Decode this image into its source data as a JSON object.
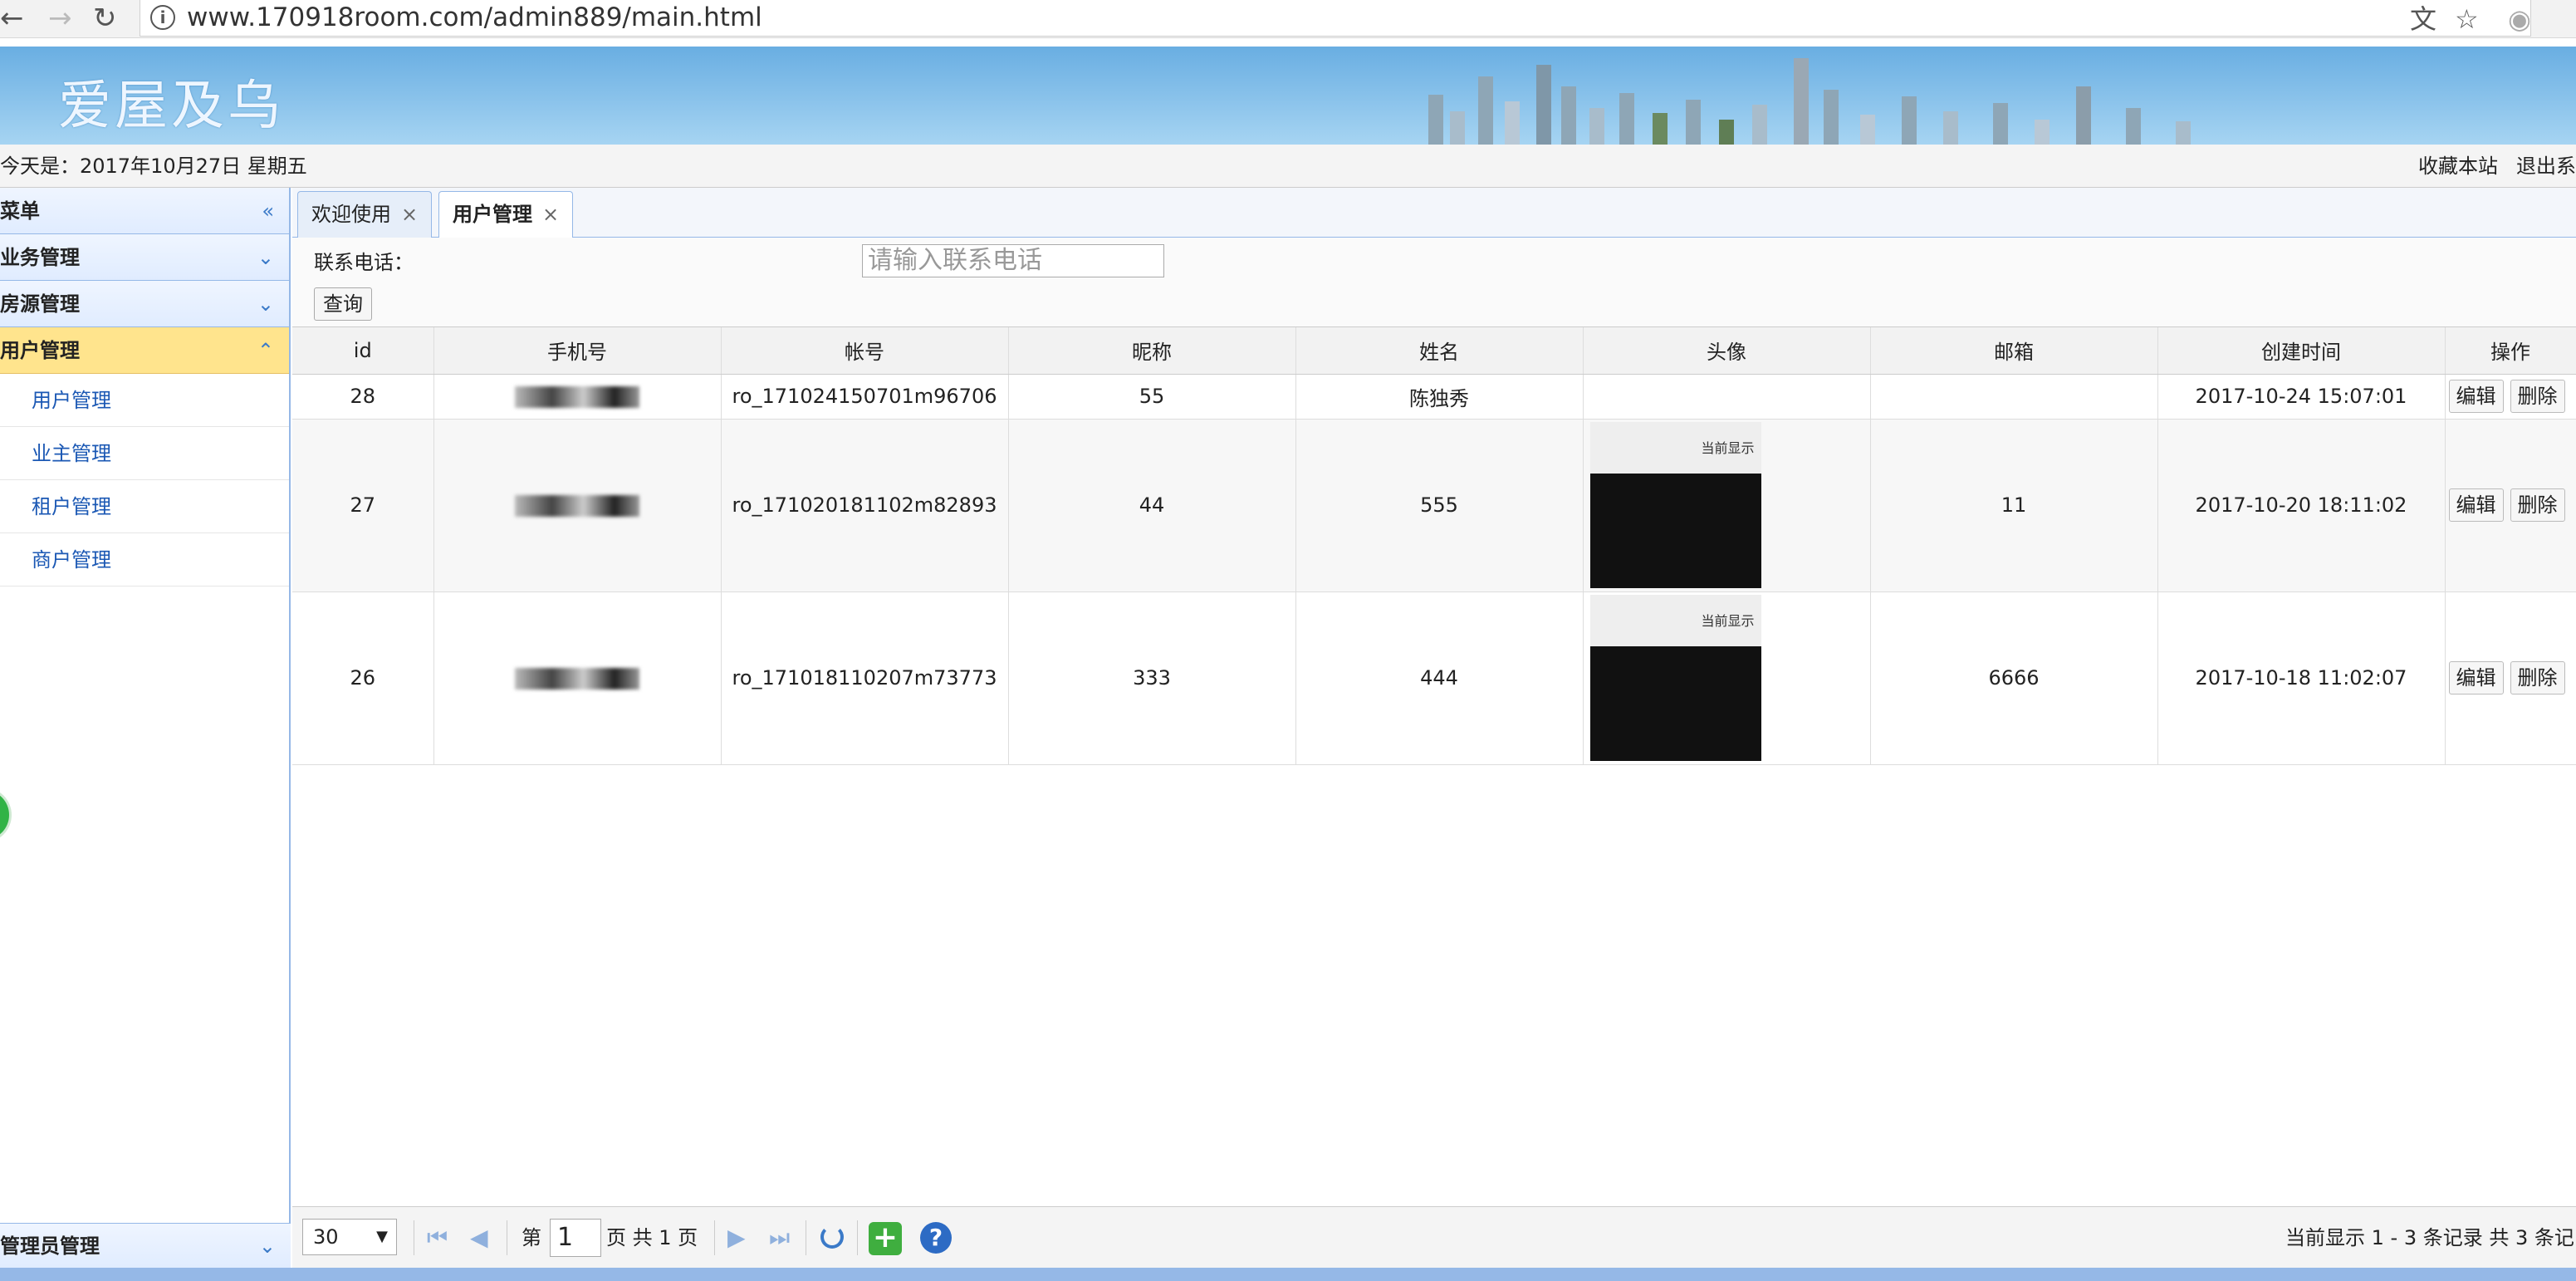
{
  "browser": {
    "url": "www.170918room.com/admin889/main.html",
    "back_icon": "arrow-left-icon",
    "forward_icon": "arrow-right-icon",
    "reload_icon": "reload-icon"
  },
  "banner": {
    "title": "爱屋及乌"
  },
  "datebar": {
    "date": "今天是：2017年10月27日 星期五",
    "favorite": "收藏本站",
    "logout": "退出系"
  },
  "sidebar": {
    "header": "菜单",
    "groups": [
      {
        "label": "业务管理"
      },
      {
        "label": "房源管理"
      },
      {
        "label": "用户管理"
      }
    ],
    "items": [
      {
        "label": "用户管理"
      },
      {
        "label": "业主管理"
      },
      {
        "label": "租户管理"
      },
      {
        "label": "商户管理"
      }
    ],
    "bottom": "管理员管理"
  },
  "tabs": [
    {
      "label": "欢迎使用"
    },
    {
      "label": "用户管理"
    }
  ],
  "search": {
    "phone_label": "联系电话：",
    "phone_placeholder": "请输入联系电话",
    "query_button": "查询"
  },
  "table": {
    "headers": [
      "id",
      "手机号",
      "帐号",
      "昵称",
      "姓名",
      "头像",
      "邮箱",
      "创建时间",
      "操作"
    ],
    "rows": [
      {
        "id": "28",
        "phone": "13077062803",
        "account": "ro_171024150701m96706",
        "nickname": "55",
        "name": "陈独秀",
        "email": "",
        "created": "2017-10-24 15:07:01"
      },
      {
        "id": "27",
        "phone": "13077062805",
        "account": "ro_171020181102m82893",
        "nickname": "44",
        "name": "555",
        "email": "11",
        "created": "2017-10-20 18:11:02"
      },
      {
        "id": "26",
        "phone": "",
        "account": "ro_171018110207m73773",
        "nickname": "333",
        "name": "444",
        "email": "6666",
        "created": "2017-10-18 11:02:07"
      }
    ],
    "edit_label": "编辑",
    "delete_label": "删除"
  },
  "pager": {
    "page_size": "30",
    "page_label": "第",
    "page_value": "1",
    "page_of": "页 共 1 页",
    "info": "当前显示 1 - 3 条记录 共 3 条记"
  },
  "colors": {
    "accent": "#95b8e7",
    "active_group": "#ffe48d",
    "link": "#1b58b4"
  }
}
